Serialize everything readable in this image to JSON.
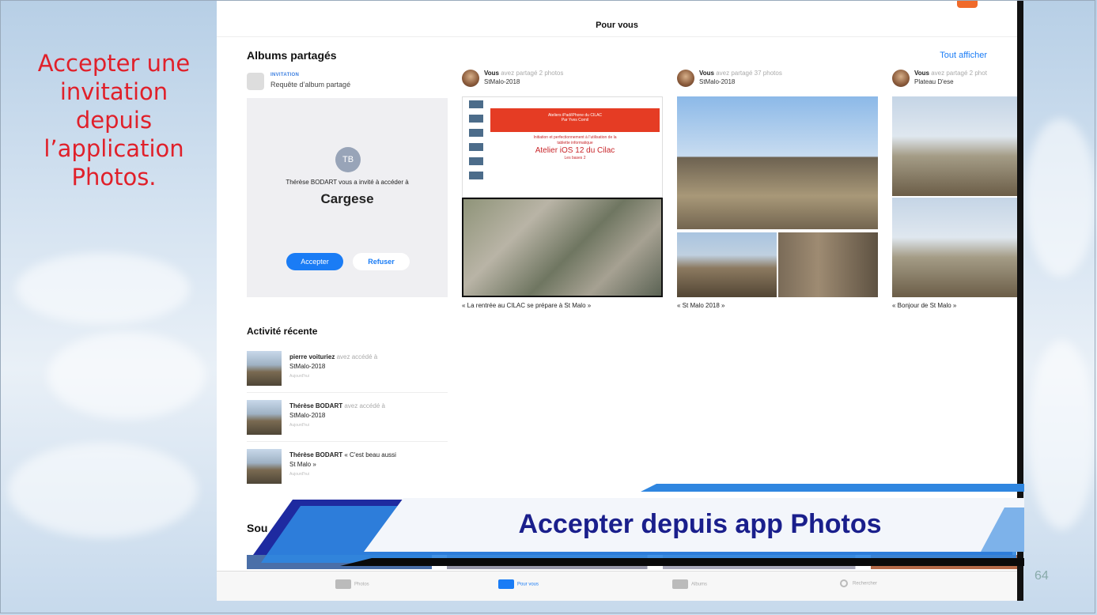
{
  "slide": {
    "caption_lines": [
      "Accepter une",
      "invitation",
      "depuis",
      "l’application",
      "Photos."
    ],
    "page_number": "64"
  },
  "ipad": {
    "nav_title": "Pour vous",
    "shared_albums": {
      "title": "Albums partagés",
      "see_all": "Tout afficher",
      "invitation": {
        "tag": "INVITATION",
        "subtitle": "Requête d’album partagé",
        "avatar_initials": "TB",
        "message": "Thérèse BODART vous a invité à accéder à",
        "album": "Cargese",
        "accept_label": "Accepter",
        "refuse_label": "Refuser"
      },
      "shares": [
        {
          "who": "Vous",
          "action": "avez partagé 2 photos",
          "album": "StMalo-2018",
          "caption": "« La rentrée au CILAC se prépare à St Malo »"
        },
        {
          "who": "Vous",
          "action": "avez partagé 37 photos",
          "album": "StMalo-2018",
          "caption": "« St Malo 2018 »"
        },
        {
          "who": "Vous",
          "action": "avez partagé 2 phot",
          "album": "Plateau D'ese",
          "caption": "« Bonjour de St Malo »"
        }
      ],
      "poster": {
        "header_line1": "Ateliers iPad/iPhone du CILAC",
        "header_line2": "Par Yves Cornil",
        "line1": "Initiation et perfectionnement à l’utilisation de la",
        "line2": "tablette informatique",
        "title": "Atelier iOS 12 du Cilac",
        "subtitle": "Les bases 2"
      }
    },
    "recent_activity": {
      "title": "Activité récente",
      "items": [
        {
          "who": "pierre voituriez",
          "action": "avez accédé à",
          "target": "StMalo-2018",
          "time": "Aujourd'hui"
        },
        {
          "who": "Thérèse BODART",
          "action": "avez accédé à",
          "target": "StMalo-2018",
          "time": "Aujourd'hui"
        },
        {
          "who": "Thérèse BODART",
          "action": "« C'est beau aussi",
          "target": "St Malo »",
          "time": "Aujourd'hui"
        }
      ]
    },
    "souvenirs_label": "Sou",
    "tabs": [
      {
        "label": "Photos",
        "icon": "photos-icon"
      },
      {
        "label": "Pour vous",
        "icon": "for-you-icon"
      },
      {
        "label": "Albums",
        "icon": "albums-icon"
      },
      {
        "label": "Rechercher",
        "icon": "search-icon"
      }
    ]
  },
  "banner": {
    "text": "Accepter depuis app Photos",
    "text_color": "#1a1f8c",
    "accent": "#1d7fd8"
  },
  "colors": {
    "caption_red": "#e0202a",
    "ios_blue": "#1a7cf5"
  }
}
